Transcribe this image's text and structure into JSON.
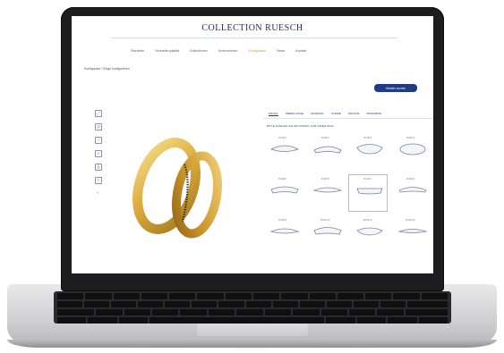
{
  "site": {
    "brand": "COLLECTION RUESCH",
    "nav": [
      "Startseite",
      "Herstellerqualität",
      "Kollektionen",
      "Unternehmen",
      "Konfigurator",
      "News",
      "Kontakt"
    ],
    "nav_active_index": 4,
    "breadcrumb": "Konfigurator / Ringe konfigurieren",
    "cta_label": "Händler suchen",
    "tabs": [
      "PROFIL",
      "OBERFLÄCHE",
      "MATERIAL",
      "STEINE",
      "GRAVUR",
      "RINGWEITE"
    ],
    "instruction": "BITTE WÄHLEN SIE EIN PROFIL FÜR IHREN RING",
    "profiles": [
      "Profil 1",
      "Profil 2",
      "Profil 3",
      "Profil 4",
      "Profil 5",
      "Profil 6",
      "Profil 7",
      "Profil 8",
      "Profil 9",
      "Profil 10",
      "Profil 11",
      "Profil 12"
    ],
    "selected_profile_index": 6
  },
  "colors": {
    "brand": "#1e2a6b",
    "cta": "#1f3a86",
    "gold": "#d9a93a",
    "laptop_bezel": "#1d1d1f"
  },
  "icons": [
    "expand-icon",
    "document-icon",
    "share-icon",
    "trash-icon",
    "print-icon",
    "refresh-icon",
    "share-alt-icon"
  ]
}
